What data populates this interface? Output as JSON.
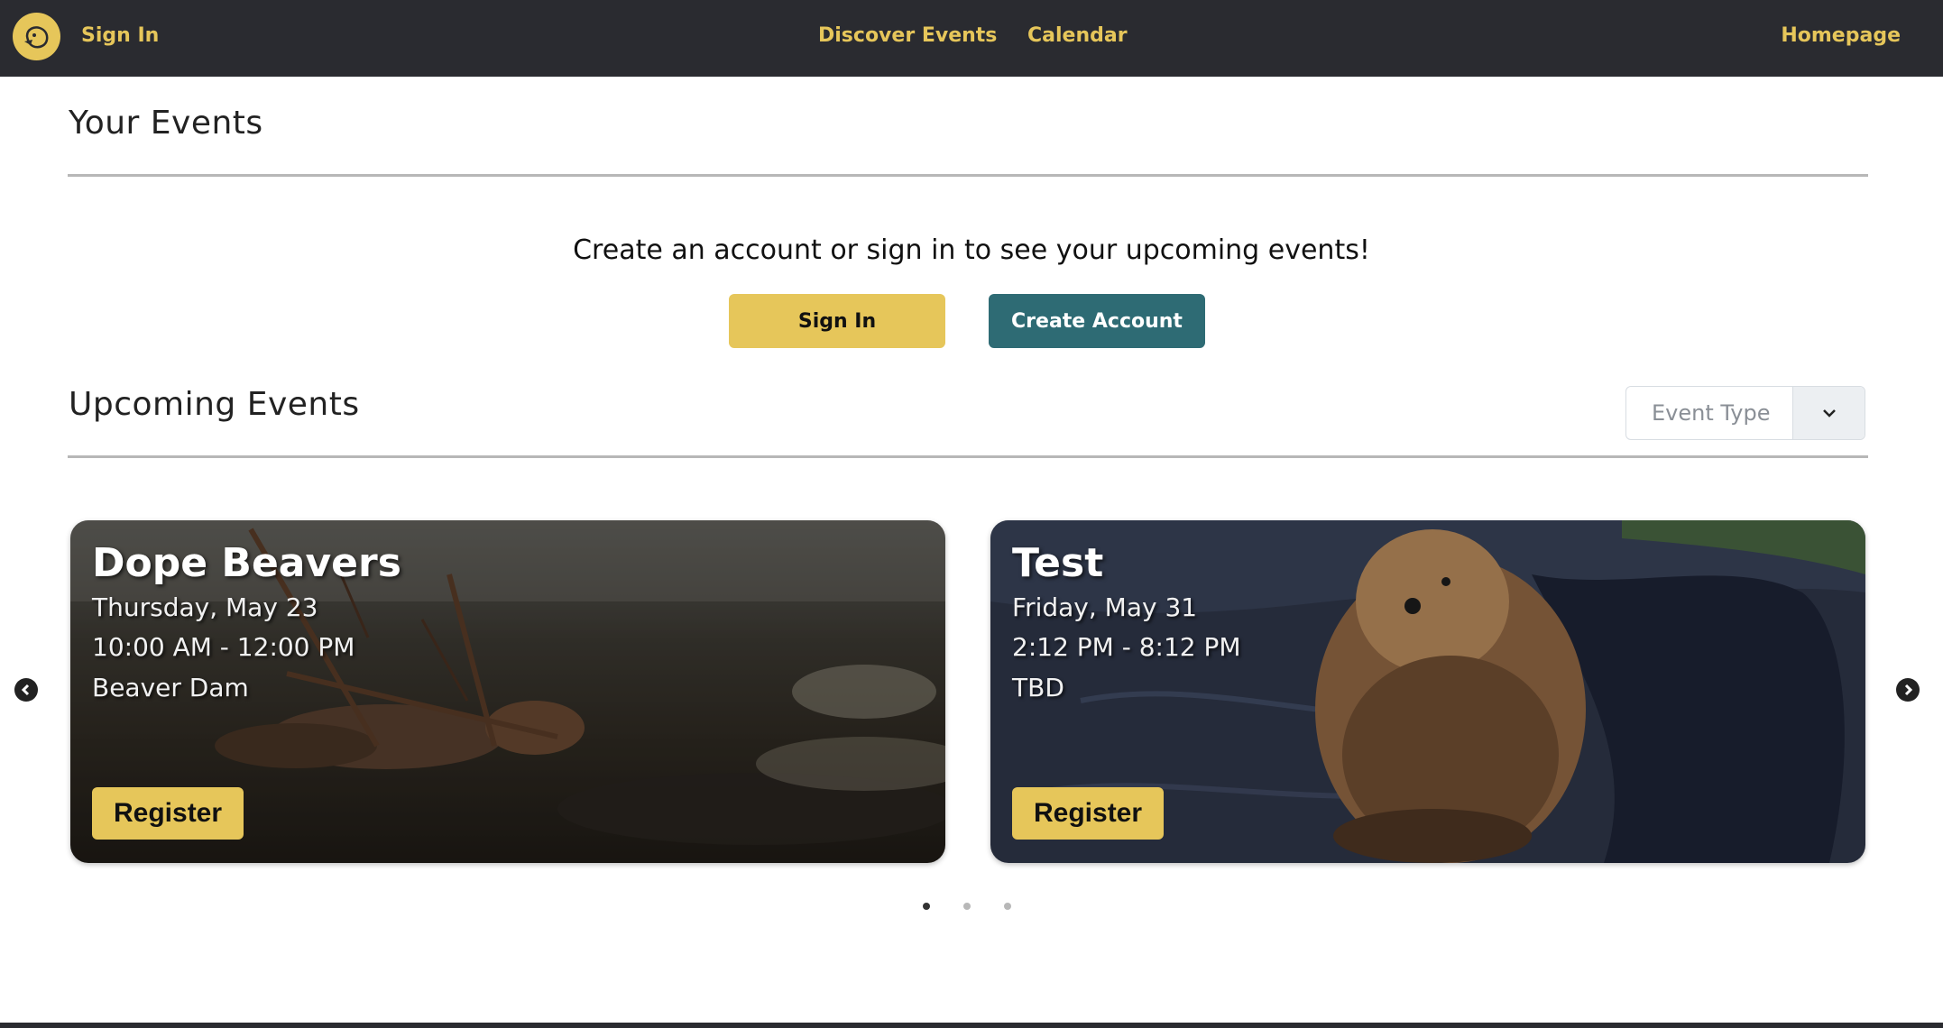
{
  "nav": {
    "sign_in": "Sign In",
    "discover": "Discover Events",
    "calendar": "Calendar",
    "homepage": "Homepage",
    "logo_icon": "beaver-logo-icon"
  },
  "your_events": {
    "title": "Your Events",
    "prompt": "Create an account or sign in to see your upcoming events!",
    "sign_in_button": "Sign In",
    "create_account_button": "Create Account"
  },
  "upcoming": {
    "title": "Upcoming Events",
    "filter_placeholder": "Event Type",
    "cards": [
      {
        "title": "Dope Beavers",
        "date": "Thursday, May 23",
        "time": "10:00 AM - 12:00 PM",
        "location": "Beaver Dam",
        "register": "Register"
      },
      {
        "title": "Test",
        "date": "Friday, May 31",
        "time": "2:12 PM - 8:12 PM",
        "location": "TBD",
        "register": "Register"
      }
    ],
    "carousel_pages": 3,
    "active_page": 1
  },
  "colors": {
    "nav_bg": "#2a2b30",
    "accent_yellow": "#e6c65a",
    "teal": "#2e6b74"
  }
}
